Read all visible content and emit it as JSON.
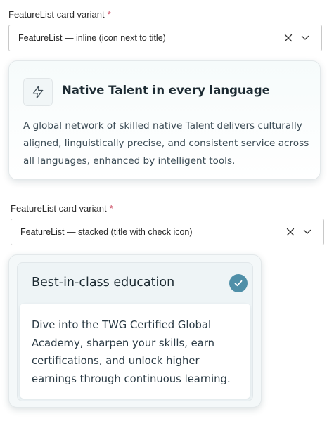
{
  "fields": [
    {
      "label": "FeatureList card variant",
      "required_mark": "*",
      "selected": "FeatureList — inline (icon next to title)"
    },
    {
      "label": "FeatureList card variant",
      "required_mark": "*",
      "selected": "FeatureList — stacked (title with check icon)"
    }
  ],
  "cards": {
    "inline": {
      "icon": "lightning-icon",
      "title": "Native Talent in every language",
      "description": "A global network of skilled native Talent delivers culturally aligned, linguistically precise, and consistent service across all languages, enhanced by intelligent tools."
    },
    "stacked": {
      "icon": "check-icon",
      "title": "Best-in-class education",
      "description": "Dive into the TWG Certified Global Academy, sharpen your skills, earn certifications, and unlock higher earnings through continuous learning."
    }
  },
  "colors": {
    "accent": "#4f8fa8",
    "required": "#c4314b"
  }
}
